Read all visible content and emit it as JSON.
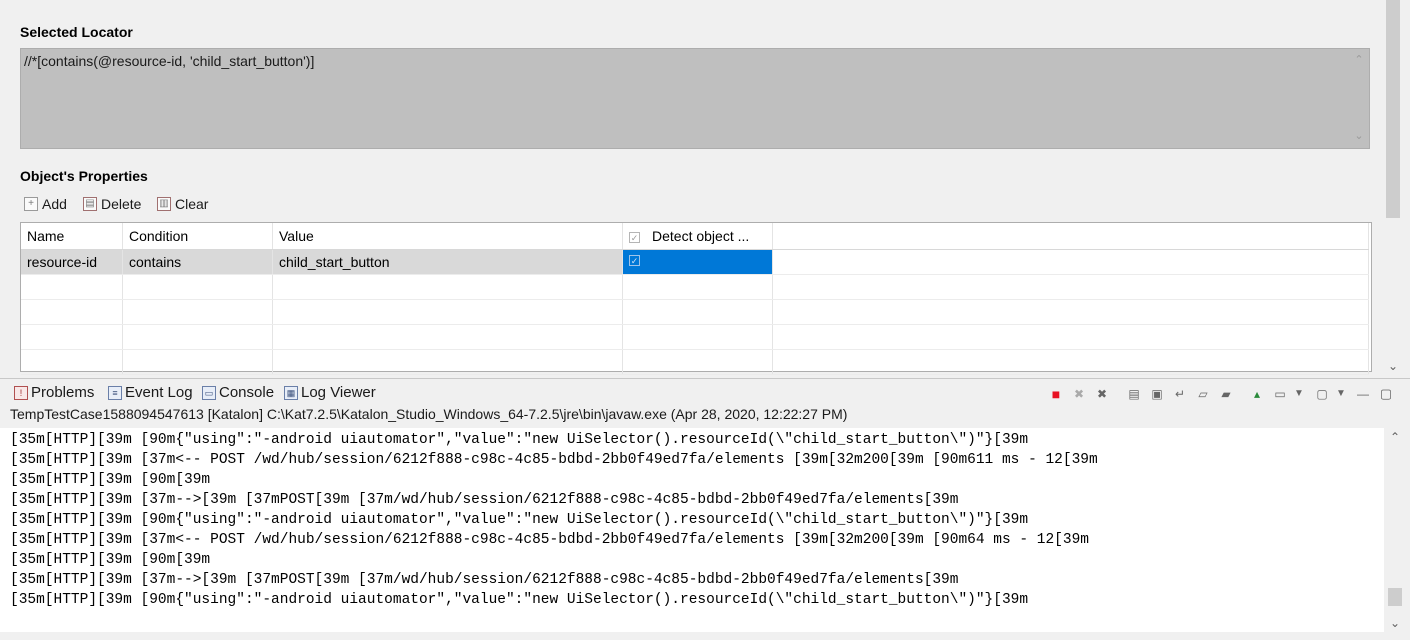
{
  "selected_locator": {
    "label": "Selected Locator",
    "value": "//*[contains(@resource-id, 'child_start_button')]"
  },
  "properties": {
    "label": "Object's Properties",
    "toolbar": {
      "add": "Add",
      "delete": "Delete",
      "clear": "Clear"
    },
    "columns": [
      "Name",
      "Condition",
      "Value",
      "Detect object ..."
    ],
    "rows": [
      {
        "name": "resource-id",
        "condition": "contains",
        "value": "child_start_button",
        "detect": true
      }
    ]
  },
  "console": {
    "tabs": [
      "Problems",
      "Event Log",
      "Console",
      "Log Viewer"
    ],
    "active_tab": "Console",
    "title": "TempTestCase1588094547613 [Katalon] C:\\Kat7.2.5\\Katalon_Studio_Windows_64-7.2.5\\jre\\bin\\javaw.exe (Apr 28, 2020, 12:22:27 PM)",
    "lines": [
      "\u001b[35m[HTTP]\u001b[39m \u001b[90m{\"using\":\"-android uiautomator\",\"value\":\"new UiSelector().resourceId(\\\"child_start_button\\\")\"}\u001b[39m",
      "\u001b[35m[HTTP]\u001b[39m \u001b[37m<-- POST /wd/hub/session/6212f888-c98c-4c85-bdbd-2bb0f49ed7fa/elements \u001b[39m\u001b[32m200\u001b[39m \u001b[90m611 ms - 12\u001b[39m",
      "\u001b[35m[HTTP]\u001b[39m \u001b[90m\u001b[39m",
      "\u001b[35m[HTTP]\u001b[39m \u001b[37m-->\u001b[39m \u001b[37mPOST\u001b[39m \u001b[37m/wd/hub/session/6212f888-c98c-4c85-bdbd-2bb0f49ed7fa/elements\u001b[39m",
      "\u001b[35m[HTTP]\u001b[39m \u001b[90m{\"using\":\"-android uiautomator\",\"value\":\"new UiSelector().resourceId(\\\"child_start_button\\\")\"}\u001b[39m",
      "\u001b[35m[HTTP]\u001b[39m \u001b[37m<-- POST /wd/hub/session/6212f888-c98c-4c85-bdbd-2bb0f49ed7fa/elements \u001b[39m\u001b[32m200\u001b[39m \u001b[90m64 ms - 12\u001b[39m",
      "\u001b[35m[HTTP]\u001b[39m \u001b[90m\u001b[39m",
      "\u001b[35m[HTTP]\u001b[39m \u001b[37m-->\u001b[39m \u001b[37mPOST\u001b[39m \u001b[37m/wd/hub/session/6212f888-c98c-4c85-bdbd-2bb0f49ed7fa/elements\u001b[39m",
      "\u001b[35m[HTTP]\u001b[39m \u001b[90m{\"using\":\"-android uiautomator\",\"value\":\"new UiSelector().resourceId(\\\"child_start_button\\\")\"}\u001b[39m"
    ]
  },
  "colors": {
    "selection": "#0078d7",
    "terminate_red": "#e81123",
    "locator_bg": "#bfbfbf"
  },
  "icons": {
    "tabs": [
      "problems-icon",
      "event-log-icon",
      "console-icon",
      "log-viewer-icon"
    ],
    "console_toolbar": [
      "terminate-icon",
      "remove-launch-icon",
      "remove-all-terminated-icon",
      "clear-console-icon",
      "scroll-lock-icon",
      "word-wrap-icon",
      "show-on-stdout-icon",
      "show-on-stderr-icon",
      "pin-console-icon",
      "display-console-icon",
      "open-console-icon",
      "minimize-icon",
      "maximize-icon"
    ]
  }
}
